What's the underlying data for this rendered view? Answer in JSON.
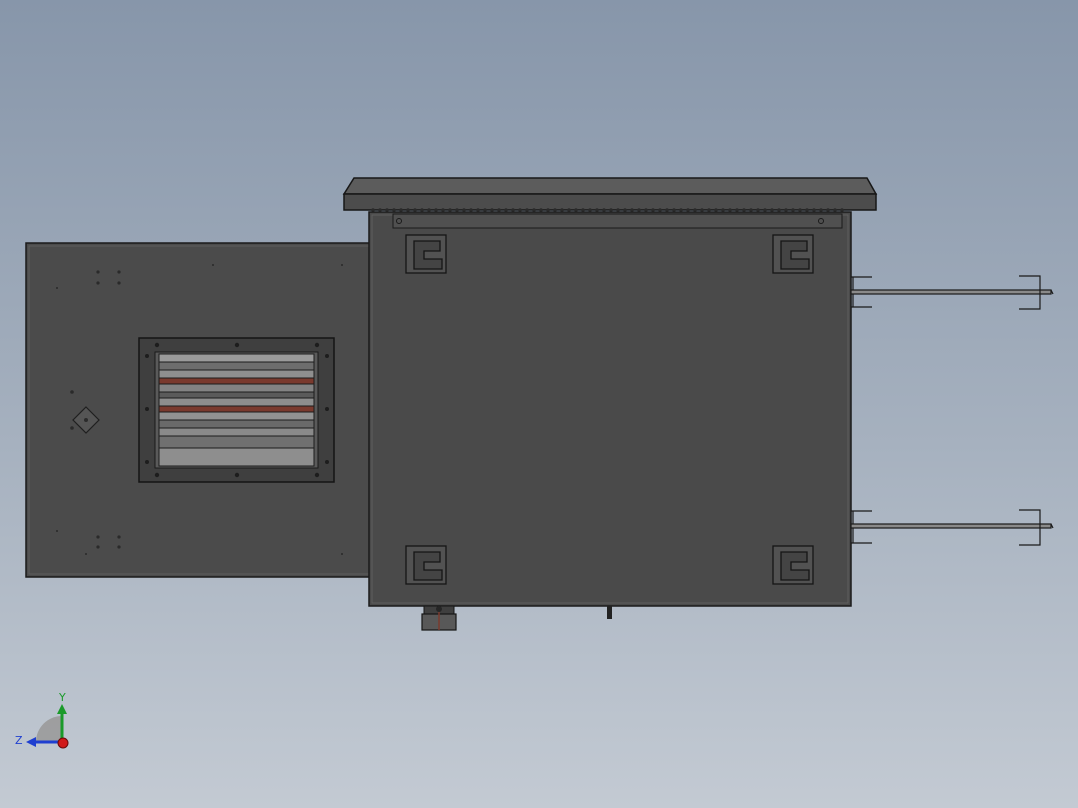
{
  "viewport": {
    "background_top": "#8796aa",
    "background_bottom": "#c3cad3"
  },
  "model": {
    "body_color": "#4a4a4a",
    "edge_color": "#1c1c1c",
    "accent_color": "#7a3a2e"
  },
  "triad": {
    "y_label": "Y",
    "z_label": "Z",
    "y_color": "#1a9a2a",
    "z_color": "#1f3fd0",
    "x_color": "#d01818"
  }
}
